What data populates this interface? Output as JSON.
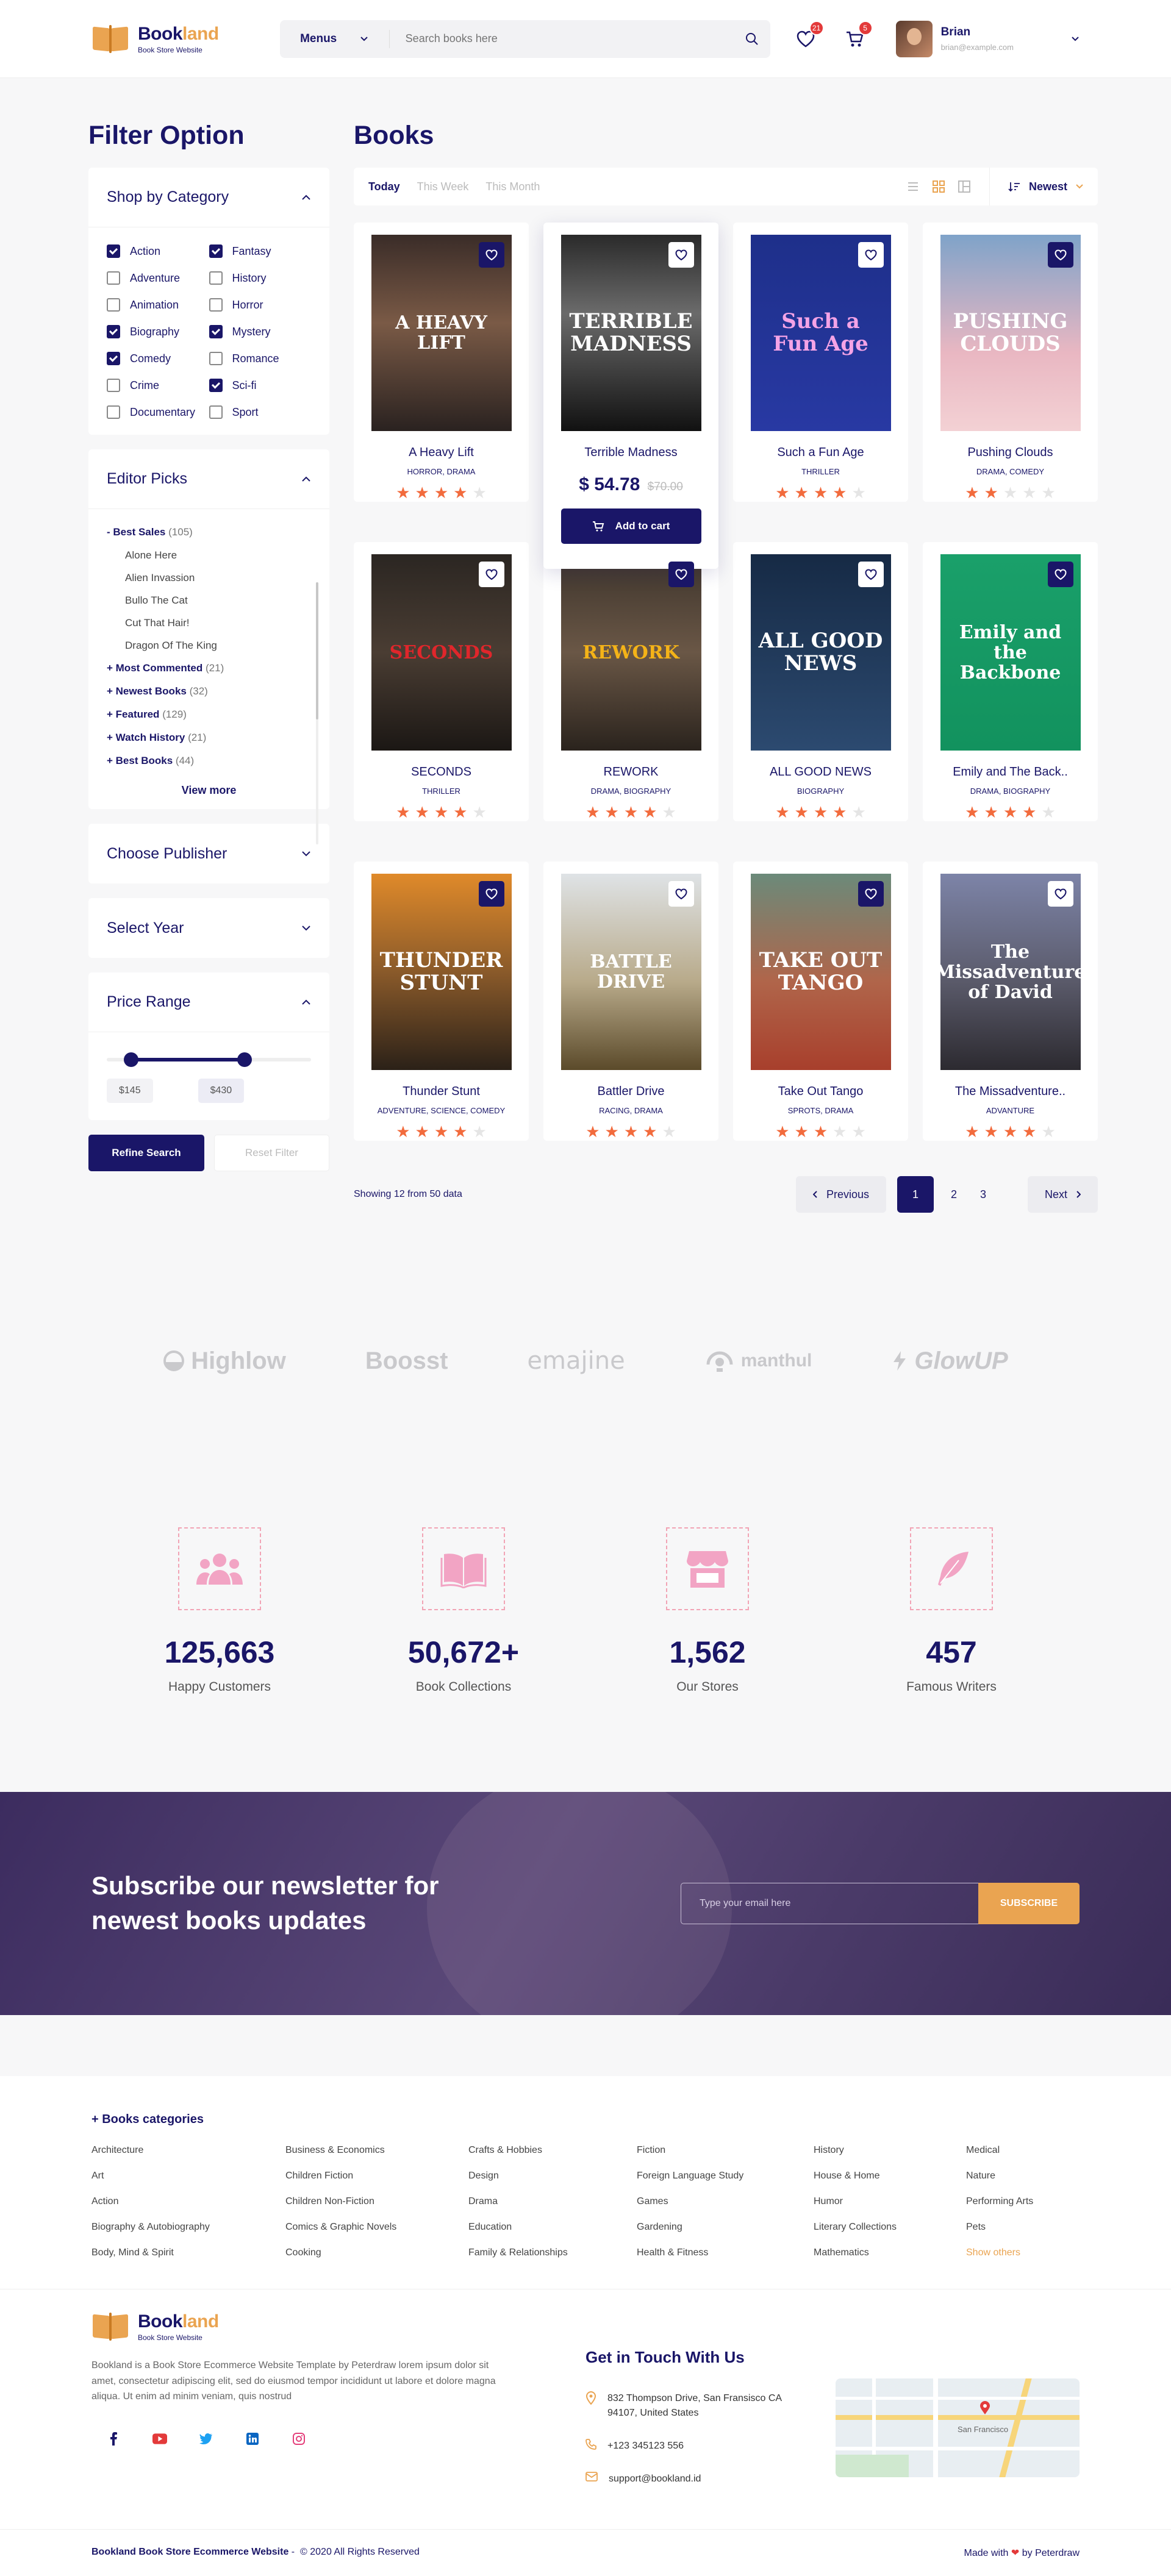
{
  "brand": {
    "name_main": "Book",
    "name_accent": "land",
    "tagline": "Book Store Website"
  },
  "header": {
    "menus_label": "Menus",
    "search_placeholder": "Search books here",
    "wishlist_count": "21",
    "cart_count": "5",
    "user_name": "Brian",
    "user_email": "brian@example.com"
  },
  "filter": {
    "title": "Filter Option",
    "category_title": "Shop by Category",
    "categories": [
      {
        "label": "Action",
        "checked": true
      },
      {
        "label": "Fantasy",
        "checked": true
      },
      {
        "label": "Adventure",
        "checked": false
      },
      {
        "label": "History",
        "checked": false
      },
      {
        "label": "Animation",
        "checked": false
      },
      {
        "label": "Horror",
        "checked": false
      },
      {
        "label": "Biography",
        "checked": true
      },
      {
        "label": "Mystery",
        "checked": true
      },
      {
        "label": "Comedy",
        "checked": true
      },
      {
        "label": "Romance",
        "checked": false
      },
      {
        "label": "Crime",
        "checked": false
      },
      {
        "label": "Sci-fi",
        "checked": true
      },
      {
        "label": "Documentary",
        "checked": false
      },
      {
        "label": "Sport",
        "checked": false
      }
    ],
    "editor_title": "Editor Picks",
    "best_sales": {
      "label": "- Best Sales",
      "count": "(105)"
    },
    "best_sales_items": [
      "Alone Here",
      "Alien Invassion",
      "Bullo The Cat",
      "Cut That Hair!",
      "Dragon Of The King"
    ],
    "groups": [
      {
        "label": "+ Most Commented",
        "count": "(21)"
      },
      {
        "label": "+ Newest Books",
        "count": "(32)"
      },
      {
        "label": "+ Featured",
        "count": "(129)"
      },
      {
        "label": "+ Watch History",
        "count": "(21)"
      },
      {
        "label": "+ Best Books",
        "count": "(44)"
      }
    ],
    "view_more": "View more",
    "publisher_title": "Choose Publisher",
    "year_title": "Select Year",
    "price_title": "Price Range",
    "price_min": "$145",
    "price_max": "$430",
    "price_range_selected": {
      "min_fraction": 0.1,
      "max_fraction": 0.6
    },
    "refine_label": "Refine Search",
    "reset_label": "Reset Filter"
  },
  "books_section": {
    "title": "Books",
    "tabs": [
      "Today",
      "This Week",
      "This Month"
    ],
    "sort_label": "Newest",
    "showing": "Showing 12 from 50 data",
    "prev_label": "Previous",
    "next_label": "Next",
    "pages": [
      "1",
      "2",
      "3"
    ]
  },
  "books": [
    {
      "title": "A Heavy Lift",
      "genre": "HORROR, DRAMA",
      "rating": 4,
      "cover_text": "A HEAVY LIFT",
      "cover_bg": "linear-gradient(180deg,#3a2c28 0%,#7a5a46 45%,#2a2220 100%)",
      "cover_color": "#ffffff",
      "fav_dark": true
    },
    {
      "title": "Terrible Madness",
      "genre": "",
      "rating": 4,
      "cover_text": "TERRIBLE MADNESS",
      "cover_bg": "linear-gradient(180deg,#2a2a2a 0%,#6b6b6b 40%,#111 100%)",
      "cover_color": "#ffffff",
      "fav_dark": false,
      "price": "$ 54.78",
      "old_price": "$70.00",
      "cart_label": "Add to cart"
    },
    {
      "title": "Such a Fun Age",
      "genre": "THRILLER",
      "rating": 4,
      "cover_text": "Such a Fun Age",
      "cover_bg": "linear-gradient(180deg,#1e2f8a 0%,#2839a3 100%)",
      "cover_color": "#f4a3e6",
      "fav_dark": false
    },
    {
      "title": "Pushing Clouds",
      "genre": "DRAMA, COMEDY",
      "rating": 2,
      "cover_text": "PUSHING CLOUDS",
      "cover_bg": "linear-gradient(180deg,#7fa3c9 0%,#e9b7c2 60%,#f3d1d4 100%)",
      "cover_color": "#ffffff",
      "fav_dark": true
    },
    {
      "title": "SECONDS",
      "genre": "THRILLER",
      "rating": 4,
      "cover_text": "SECONDS",
      "cover_bg": "linear-gradient(180deg,#2b2622 0%,#4a3d33 50%,#1b1714 100%)",
      "cover_color": "#e0262b",
      "fav_dark": false
    },
    {
      "title": "REWORK",
      "genre": "DRAMA, BIOGRAPHY",
      "rating": 4,
      "cover_text": "REWORK",
      "cover_bg": "linear-gradient(180deg,#3d342c 0%,#6a5746 50%,#2a231d 100%)",
      "cover_color": "#f4b318",
      "fav_dark": true
    },
    {
      "title": "ALL GOOD NEWS",
      "genre": "BIOGRAPHY",
      "rating": 4,
      "cover_text": "ALL GOOD NEWS",
      "cover_bg": "linear-gradient(180deg,#162a45 0%,#2c4a70 100%)",
      "cover_color": "#ffffff",
      "fav_dark": false
    },
    {
      "title": "Emily and The Back..",
      "genre": "DRAMA, BIOGRAPHY",
      "rating": 4,
      "cover_text": "Emily and the Backbone",
      "cover_bg": "linear-gradient(180deg,#1aa06a 0%,#12925e 100%)",
      "cover_color": "#ffffff",
      "fav_dark": true
    },
    {
      "title": "Thunder Stunt",
      "genre": "ADVENTURE, SCIENCE, COMEDY",
      "rating": 4,
      "cover_text": "THUNDER STUNT",
      "cover_bg": "linear-gradient(180deg,#e08a2a 0%,#8a5a2a 50%,#2b2118 100%)",
      "cover_color": "#ffffff",
      "fav_dark": true
    },
    {
      "title": "Battler Drive",
      "genre": "RACING, DRAMA",
      "rating": 4,
      "cover_text": "BATTLE DRIVE",
      "cover_bg": "linear-gradient(180deg,#dfe3e6 0%,#b8aa8a 55%,#5b4a2a 100%)",
      "cover_color": "#ffffff",
      "fav_dark": false
    },
    {
      "title": "Take Out Tango",
      "genre": "SPROTS, DRAMA",
      "rating": 3,
      "cover_text": "TAKE OUT TANGO",
      "cover_bg": "linear-gradient(180deg,#6b8a7a 0%,#b0654a 55%,#a83f2c 100%)",
      "cover_color": "#ffffff",
      "fav_dark": true
    },
    {
      "title": "The Missadventure..",
      "genre": "ADVANTURE",
      "rating": 4,
      "cover_text": "The Missadventure of David",
      "cover_bg": "linear-gradient(180deg,#7d84a8 0%,#5a5a6a 55%,#2c2a30 100%)",
      "cover_color": "#ffffff",
      "fav_dark": false
    }
  ],
  "brands": [
    "Highlow",
    "Boosst",
    "emajine",
    "manthul",
    "GlowUP"
  ],
  "stats": [
    {
      "value": "125,663",
      "label": "Happy Customers",
      "icon": "users-icon"
    },
    {
      "value": "50,672+",
      "label": "Book Collections",
      "icon": "book-icon"
    },
    {
      "value": "1,562",
      "label": "Our Stores",
      "icon": "store-icon"
    },
    {
      "value": "457",
      "label": "Famous Writers",
      "icon": "feather-icon"
    }
  ],
  "newsletter": {
    "title": "Subscribe our newsletter for newest books updates",
    "placeholder": "Type your email here",
    "button": "SUBSCRIBE"
  },
  "footer": {
    "categories_title": "+ Books categories",
    "categories": [
      "Architecture",
      "Business & Economics",
      "Crafts & Hobbies",
      "Fiction",
      "History",
      "Medical",
      "Art",
      "Children Fiction",
      "Design",
      "Foreign Language Study",
      "House & Home",
      "Nature",
      "Action",
      "Children Non-Fiction",
      "Drama",
      "Games",
      "Humor",
      "Performing Arts",
      "Biography & Autobiography",
      "Comics & Graphic Novels",
      "Education",
      "Gardening",
      "Literary Collections",
      "Pets",
      "Body, Mind & Spirit",
      "Cooking",
      "Family & Relationships",
      "Health & Fitness",
      "Mathematics",
      "Show others"
    ],
    "description": "Bookland is a Book Store Ecommerce Website Template by Peterdraw lorem ipsum dolor sit amet, consectetur adipiscing elit, sed do eiusmod tempor incididunt ut labore et dolore magna aliqua. Ut enim ad minim veniam, quis nostrud",
    "contact_title": "Get in Touch With Us",
    "address": "832  Thompson Drive, San Fransisco CA 94107, United States",
    "phone": "+123 345123 556",
    "email": "support@bookland.id",
    "map_label": "San Francisco",
    "copyright_brand": "Bookland Book Store Ecommerce Website",
    "copyright_text": "© 2020 All Rights Reserved",
    "made_with": "Made with",
    "made_by": "by Peterdraw"
  }
}
